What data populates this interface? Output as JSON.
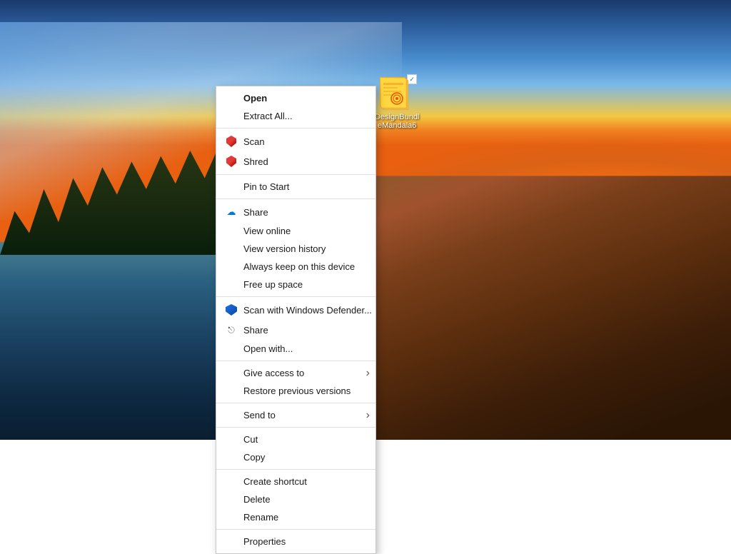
{
  "desktop": {
    "icon": {
      "label_line1": "DesignBundl",
      "label_line2": "eMandala6"
    }
  },
  "context_menu": {
    "items": [
      {
        "id": "open",
        "label": "Open",
        "bold": true,
        "icon": null,
        "separator_after": false
      },
      {
        "id": "extract-all",
        "label": "Extract All...",
        "bold": false,
        "icon": null,
        "separator_after": true
      },
      {
        "id": "scan",
        "label": "Scan",
        "bold": false,
        "icon": "mcafee",
        "separator_after": false
      },
      {
        "id": "shred",
        "label": "Shred",
        "bold": false,
        "icon": "mcafee",
        "separator_after": true
      },
      {
        "id": "pin-to-start",
        "label": "Pin to Start",
        "bold": false,
        "icon": null,
        "separator_after": true
      },
      {
        "id": "share-onedrive",
        "label": "Share",
        "bold": false,
        "icon": "onedrive",
        "separator_after": false
      },
      {
        "id": "view-online",
        "label": "View online",
        "bold": false,
        "icon": null,
        "separator_after": false
      },
      {
        "id": "view-version-history",
        "label": "View version history",
        "bold": false,
        "icon": null,
        "separator_after": false
      },
      {
        "id": "always-keep",
        "label": "Always keep on this device",
        "bold": false,
        "icon": null,
        "separator_after": false
      },
      {
        "id": "free-up-space",
        "label": "Free up space",
        "bold": false,
        "icon": null,
        "separator_after": true
      },
      {
        "id": "scan-defender",
        "label": "Scan with Windows Defender...",
        "bold": false,
        "icon": "defender",
        "separator_after": false
      },
      {
        "id": "share",
        "label": "Share",
        "bold": false,
        "icon": "share",
        "separator_after": false
      },
      {
        "id": "open-with",
        "label": "Open with...",
        "bold": false,
        "icon": null,
        "separator_after": true
      },
      {
        "id": "give-access",
        "label": "Give access to",
        "bold": false,
        "icon": null,
        "has_arrow": true,
        "separator_after": false
      },
      {
        "id": "restore-previous",
        "label": "Restore previous versions",
        "bold": false,
        "icon": null,
        "separator_after": true
      },
      {
        "id": "send-to",
        "label": "Send to",
        "bold": false,
        "icon": null,
        "has_arrow": true,
        "separator_after": true
      },
      {
        "id": "cut",
        "label": "Cut",
        "bold": false,
        "icon": null,
        "separator_after": false
      },
      {
        "id": "copy",
        "label": "Copy",
        "bold": false,
        "icon": null,
        "separator_after": true
      },
      {
        "id": "create-shortcut",
        "label": "Create shortcut",
        "bold": false,
        "icon": null,
        "separator_after": false
      },
      {
        "id": "delete",
        "label": "Delete",
        "bold": false,
        "icon": null,
        "separator_after": false
      },
      {
        "id": "rename",
        "label": "Rename",
        "bold": false,
        "icon": null,
        "separator_after": true
      },
      {
        "id": "properties",
        "label": "Properties",
        "bold": false,
        "icon": null,
        "separator_after": false
      }
    ]
  }
}
